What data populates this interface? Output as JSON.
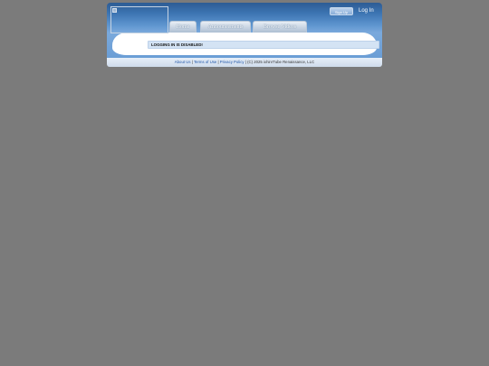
{
  "header": {
    "signup_label": "Sign Up",
    "login_label": "Log In"
  },
  "tabs": [
    {
      "label": "Home"
    },
    {
      "label": "Announcements"
    },
    {
      "label": "Browse Videos"
    }
  ],
  "alert": {
    "text": "LOGGING IN IS DISABLED!"
  },
  "footer": {
    "about": "About Us",
    "terms": "Terms of Use",
    "privacy": "Privacy Policy",
    "separator": "|",
    "copyright": "(C) 2025 ixhinrTube Renaissance, LLC"
  }
}
